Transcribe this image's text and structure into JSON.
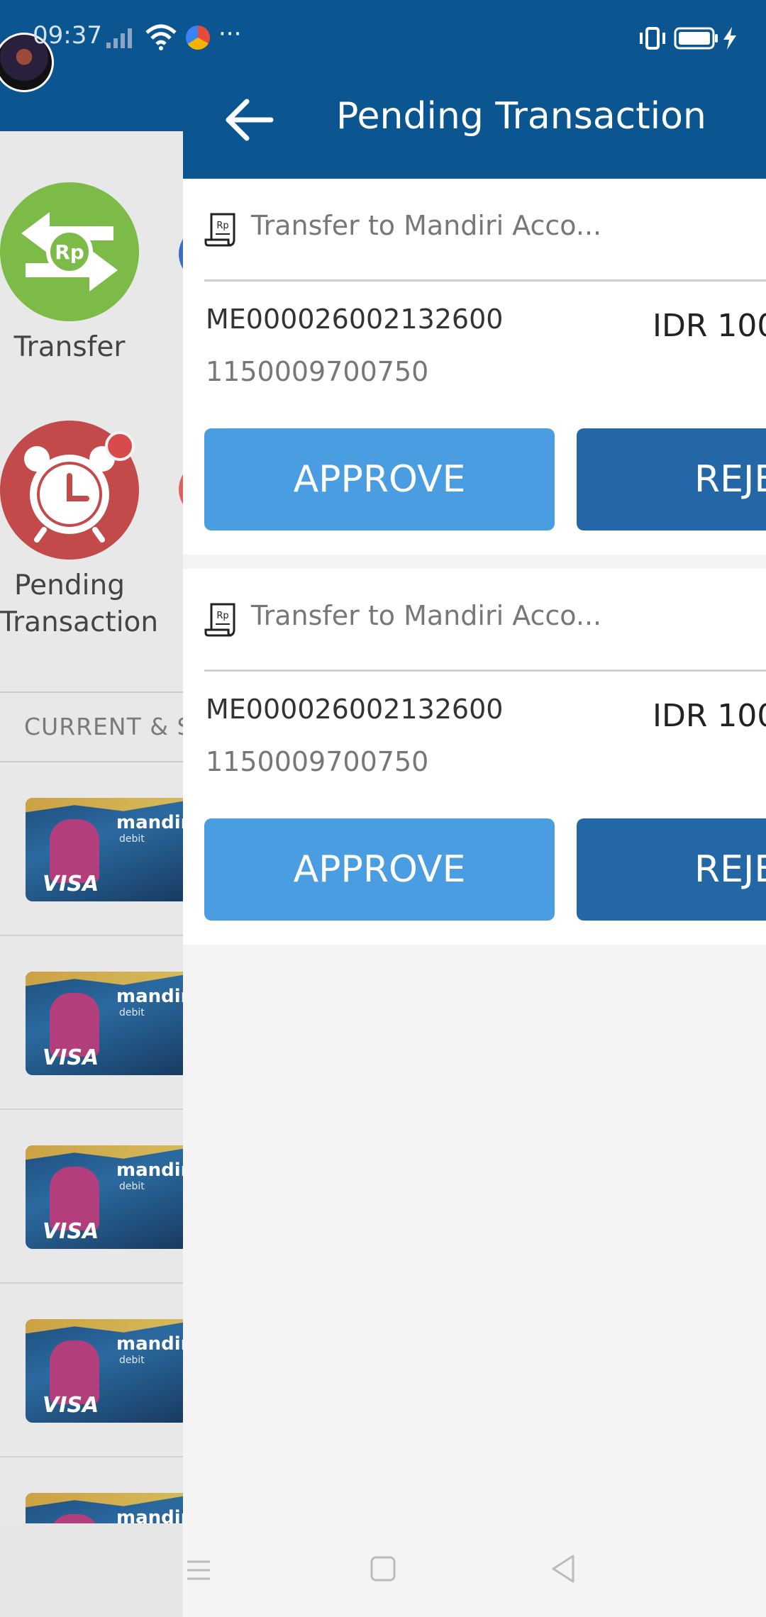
{
  "status_bar": {
    "time": "09:37",
    "more": "···"
  },
  "background_app": {
    "menu": [
      {
        "label": "Transfer"
      },
      {
        "label": "Pending\nTransaction"
      }
    ],
    "section_title": "CURRENT & S",
    "card_brand": "mandiri",
    "card_sub": "debit",
    "card_network": "VISA"
  },
  "header": {
    "title": "Pending Transaction"
  },
  "transactions": [
    {
      "description": "Transfer to Mandiri Acco...",
      "reference": "ME000026002132600",
      "account": "1150009700750",
      "amount": "IDR 100",
      "approve_label": "APPROVE",
      "reject_label": "REJE"
    },
    {
      "description": "Transfer to Mandiri Acco...",
      "reference": "ME000026002132600",
      "account": "1150009700750",
      "amount": "IDR 100",
      "approve_label": "APPROVE",
      "reject_label": "REJE"
    }
  ],
  "colors": {
    "primary": "#0b5590",
    "approve": "#4a9de0",
    "reject": "#2467a6",
    "transfer_icon": "#7dbb48",
    "pending_icon": "#c24a4a"
  }
}
